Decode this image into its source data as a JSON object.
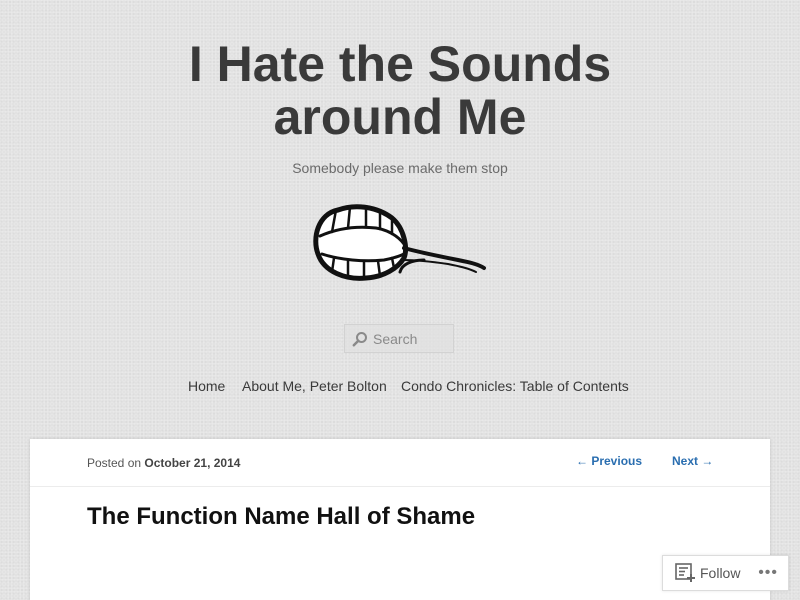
{
  "header": {
    "title_line1": "I Hate the Sounds",
    "title_line2": "around Me",
    "tagline": "Somebody please make them stop"
  },
  "search": {
    "placeholder": "Search"
  },
  "nav": {
    "items": [
      {
        "label": "Home"
      },
      {
        "label": "About Me, Peter Bolton"
      },
      {
        "label": "Condo Chronicles: Table of Contents"
      }
    ]
  },
  "post": {
    "posted_on_label": "Posted on",
    "date": "October 21, 2014",
    "previous_label": "← Previous",
    "next_label": "Next →",
    "title": "The Function Name Hall of Shame"
  },
  "follow_widget": {
    "label": "Follow",
    "more_label": "•••"
  },
  "colors": {
    "background": "#e2e2e2",
    "title": "#3a3a3a",
    "link_blue": "#2a6eb0",
    "card": "#ffffff"
  },
  "icons": [
    "header-mouth-image",
    "search-icon",
    "follow-reader-icon",
    "more-options-icon"
  ]
}
